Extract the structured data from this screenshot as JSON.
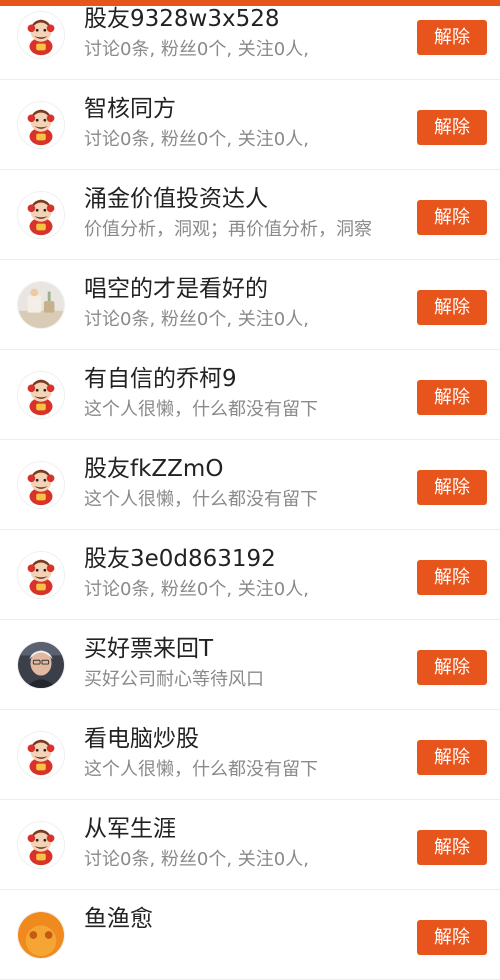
{
  "button_color": "#e8551c",
  "remove_label": "解除",
  "users": [
    {
      "name": "股友9328w3x528",
      "desc": "讨论0条, 粉丝0个, 关注0人,",
      "avatar": "mascot-avatar-icon"
    },
    {
      "name": "智核同方",
      "desc": "讨论0条, 粉丝0个, 关注0人,",
      "avatar": "mascot-avatar-icon"
    },
    {
      "name": "涌金价值投资达人",
      "desc": "价值分析，洞观；再价值分析，洞察",
      "avatar": "mascot-avatar-icon"
    },
    {
      "name": "唱空的才是看好的",
      "desc": "讨论0条, 粉丝0个, 关注0人,",
      "avatar": "room-photo-avatar"
    },
    {
      "name": "有自信的乔柯9",
      "desc": "这个人很懒，什么都没有留下",
      "avatar": "mascot-avatar-icon"
    },
    {
      "name": "股友fkZZmO",
      "desc": "这个人很懒，什么都没有留下",
      "avatar": "mascot-avatar-icon"
    },
    {
      "name": "股友3e0d863192",
      "desc": "讨论0条, 粉丝0个, 关注0人,",
      "avatar": "mascot-avatar-icon"
    },
    {
      "name": "买好票来回T",
      "desc": "买好公司耐心等待风口",
      "avatar": "person-photo-avatar"
    },
    {
      "name": "看电脑炒股",
      "desc": "这个人很懒，什么都没有留下",
      "avatar": "mascot-avatar-icon"
    },
    {
      "name": "从军生涯",
      "desc": "讨论0条, 粉丝0个, 关注0人,",
      "avatar": "mascot-avatar-icon"
    },
    {
      "name": "鱼渔愈",
      "desc": "",
      "avatar": "orange-photo-avatar"
    }
  ]
}
